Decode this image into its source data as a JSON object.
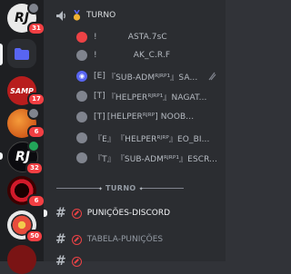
{
  "servers": [
    {
      "id": "rj-top",
      "label": "RJ",
      "sublabel": "",
      "badge": "31",
      "bg": "#eaeaea",
      "fg": "#101010"
    },
    {
      "id": "folder",
      "label": "",
      "badge": "",
      "bg": "#2b2d31"
    },
    {
      "id": "samp",
      "label": "SAMP",
      "sublabel": "",
      "badge": "17",
      "bg": "#b81d1d",
      "fg": "#ffffff"
    },
    {
      "id": "orange",
      "label": "",
      "badge": "6",
      "bg": "#e76a1a"
    },
    {
      "id": "rj-mid",
      "label": "RJ",
      "sublabel": "",
      "badge": "32",
      "bg": "#0b0b0f",
      "fg": "#ffffff"
    },
    {
      "id": "red-ring",
      "label": "",
      "badge": "6",
      "bg": "#4a0a0a"
    },
    {
      "id": "circle-art",
      "label": "",
      "badge": "50",
      "bg": "#d94a3a"
    },
    {
      "id": "bottom",
      "label": "",
      "badge": "",
      "bg": "#7a1414"
    }
  ],
  "voice": {
    "channel_name": "TURNO",
    "members": [
      {
        "prefix": "!",
        "name": "ASTA.7sC",
        "avatar": "red"
      },
      {
        "prefix": "!",
        "name": "AK_C.R.F",
        "avatar": "gray"
      },
      {
        "prefix": "[E]",
        "name": "『SUB-ADMᴿᴶᴿᴾ¹』SA...",
        "avatar": "blue"
      },
      {
        "prefix": "[T]",
        "name": "『HELPERᴿᴶᴿᴾ¹』NAGAT...",
        "avatar": "gray"
      },
      {
        "prefix": "[T]",
        "name": "[HELPERᴿᴶᴿᴾ] NOOB...",
        "avatar": "gray"
      },
      {
        "prefix": "『E』",
        "name": "『HELPERᴿᴶᴿᴾ』EO_BI...",
        "avatar": "gray"
      },
      {
        "prefix": "『T』",
        "name": "『SUB-ADMᴿᴶᴿᴾ¹』ESCR...",
        "avatar": "gray"
      }
    ]
  },
  "category": {
    "label": "TURNO"
  },
  "channels": [
    {
      "name": "PUNIÇÕES-DISCORD",
      "active": true
    },
    {
      "name": "TABELA-PUNIÇÕES",
      "active": false
    }
  ]
}
